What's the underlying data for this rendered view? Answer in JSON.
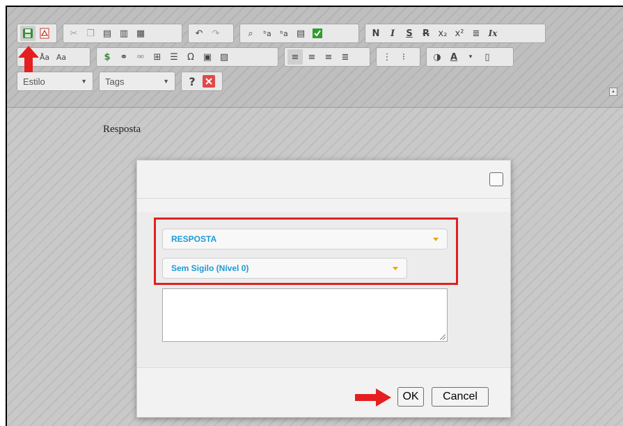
{
  "toolbar": {
    "row1_icons": [
      "save-icon",
      "pdf-icon",
      "cut-icon",
      "copy-icon",
      "paste-icon",
      "paste-text-icon",
      "paste-word-icon",
      "undo-icon",
      "redo-icon",
      "find-icon",
      "replace-icon",
      "replace-all-icon",
      "select-all-icon",
      "spellcheck-icon",
      "bold-icon",
      "italic-icon",
      "underline-icon",
      "strikethrough-icon",
      "subscript-icon",
      "superscript-icon",
      "align-icon",
      "remove-format-icon"
    ],
    "bold_label": "N",
    "italic_label": "I",
    "underline_label": "S",
    "strike_label": "R",
    "subscript_label": "x₂",
    "superscript_label": "x²",
    "removeformat_label": "Ix",
    "style_combo": "Estilo",
    "tags_combo": "Tags",
    "help_label": "?",
    "close_label": "✕"
  },
  "editor": {
    "content_text": "Resposta"
  },
  "dialog": {
    "type_select_value": "RESPOSTA",
    "secrecy_select_value": "Sem Sigilo (Nível 0)",
    "textarea_value": "",
    "ok_label": "OK",
    "cancel_label": "Cancel"
  },
  "colors": {
    "accent": "#1a9bd7",
    "caret": "#f0a500",
    "highlight": "#e02020"
  }
}
